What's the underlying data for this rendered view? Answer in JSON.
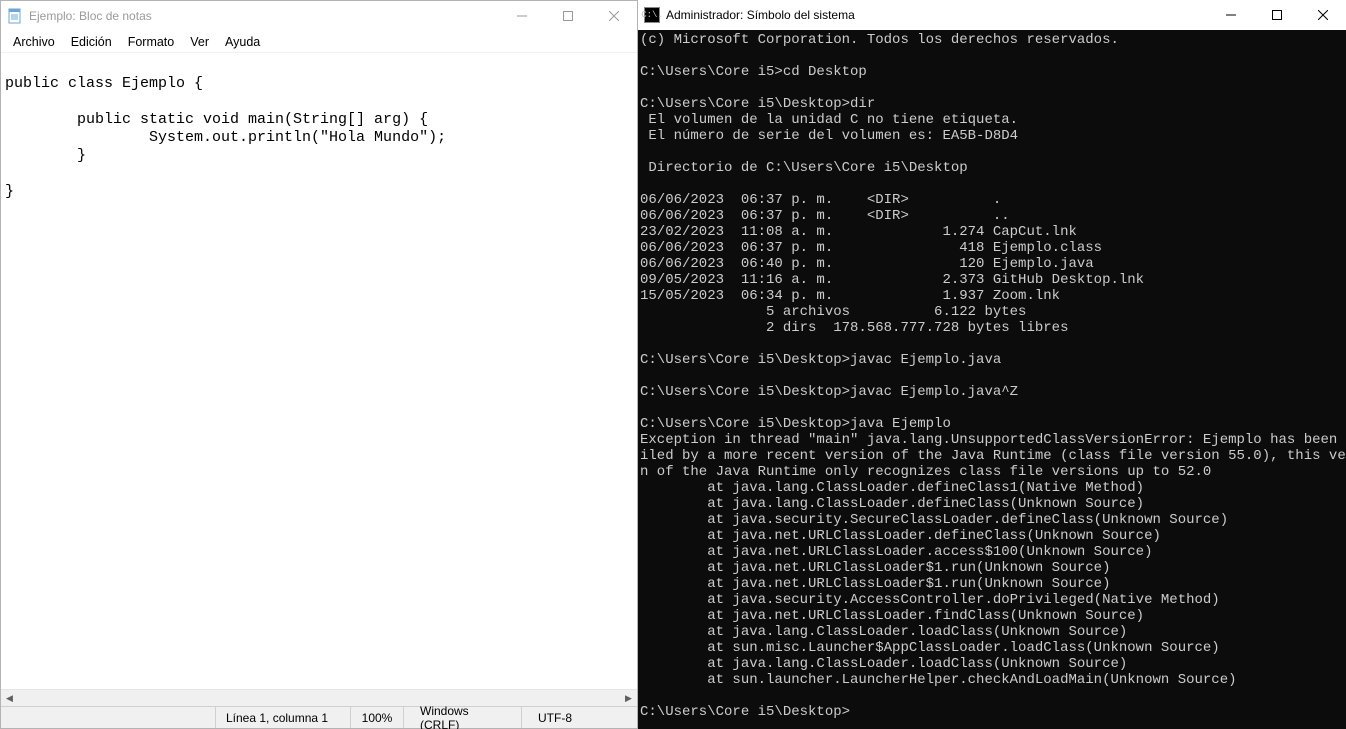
{
  "notepad": {
    "title": "Ejemplo: Bloc de notas",
    "menu": {
      "file": "Archivo",
      "edit": "Edición",
      "format": "Formato",
      "view": "Ver",
      "help": "Ayuda"
    },
    "content": "\npublic class Ejemplo {\n\n        public static void main(String[] arg) {\n                System.out.println(\"Hola Mundo\");\n        }\n\n}",
    "status": {
      "position": "Línea 1, columna 1",
      "zoom": "100%",
      "eol": "Windows (CRLF)",
      "encoding": "UTF-8"
    }
  },
  "cmd": {
    "title": "Administrador: Símbolo del sistema",
    "icon_glyph": "C:\\.",
    "output": "(c) Microsoft Corporation. Todos los derechos reservados.\n\nC:\\Users\\Core i5>cd Desktop\n\nC:\\Users\\Core i5\\Desktop>dir\n El volumen de la unidad C no tiene etiqueta.\n El número de serie del volumen es: EA5B-D8D4\n\n Directorio de C:\\Users\\Core i5\\Desktop\n\n06/06/2023  06:37 p. m.    <DIR>          .\n06/06/2023  06:37 p. m.    <DIR>          ..\n23/02/2023  11:08 a. m.             1.274 CapCut.lnk\n06/06/2023  06:37 p. m.               418 Ejemplo.class\n06/06/2023  06:40 p. m.               120 Ejemplo.java\n09/05/2023  11:16 a. m.             2.373 GitHub Desktop.lnk\n15/05/2023  06:34 p. m.             1.937 Zoom.lnk\n               5 archivos          6.122 bytes\n               2 dirs  178.568.777.728 bytes libres\n\nC:\\Users\\Core i5\\Desktop>javac Ejemplo.java\n\nC:\\Users\\Core i5\\Desktop>javac Ejemplo.java^Z\n\nC:\\Users\\Core i5\\Desktop>java Ejemplo\nException in thread \"main\" java.lang.UnsupportedClassVersionError: Ejemplo has been comp\niled by a more recent version of the Java Runtime (class file version 55.0), this versio\nn of the Java Runtime only recognizes class file versions up to 52.0\n        at java.lang.ClassLoader.defineClass1(Native Method)\n        at java.lang.ClassLoader.defineClass(Unknown Source)\n        at java.security.SecureClassLoader.defineClass(Unknown Source)\n        at java.net.URLClassLoader.defineClass(Unknown Source)\n        at java.net.URLClassLoader.access$100(Unknown Source)\n        at java.net.URLClassLoader$1.run(Unknown Source)\n        at java.net.URLClassLoader$1.run(Unknown Source)\n        at java.security.AccessController.doPrivileged(Native Method)\n        at java.net.URLClassLoader.findClass(Unknown Source)\n        at java.lang.ClassLoader.loadClass(Unknown Source)\n        at sun.misc.Launcher$AppClassLoader.loadClass(Unknown Source)\n        at java.lang.ClassLoader.loadClass(Unknown Source)\n        at sun.launcher.LauncherHelper.checkAndLoadMain(Unknown Source)\n\nC:\\Users\\Core i5\\Desktop>"
  }
}
